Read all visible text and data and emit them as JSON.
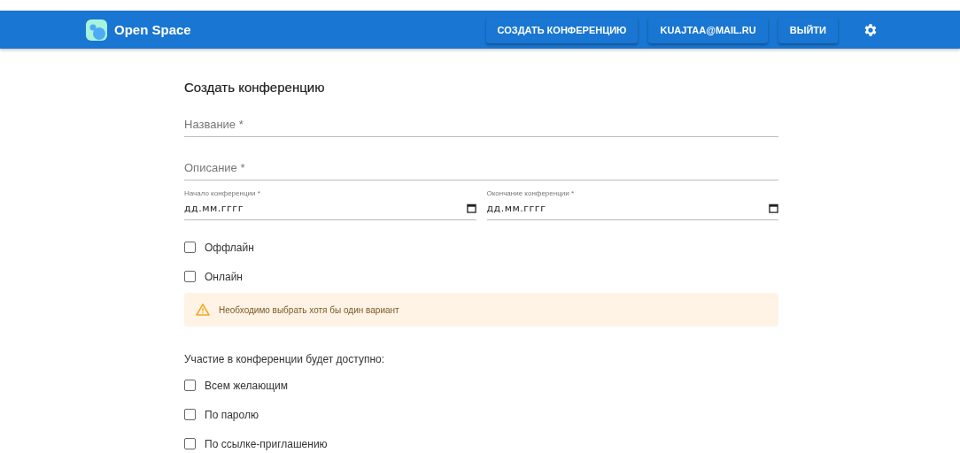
{
  "header": {
    "brand": "Open Space",
    "buttons": [
      "СОЗДАТЬ КОНФЕРЕНЦИЮ",
      "KUAJTAA@MAIL.RU",
      "ВЫЙТИ"
    ]
  },
  "form": {
    "title": "Создать конференцию",
    "fields": [
      {
        "placeholder": "Название *"
      },
      {
        "placeholder": "Описание *"
      }
    ],
    "dates": [
      {
        "label": "Начало конференции *",
        "placeholder": "дд.мм.гггг"
      },
      {
        "label": "Окончание конференции *",
        "placeholder": "дд.мм.гггг"
      }
    ],
    "formats": [
      {
        "label": "Оффлайн",
        "checked": false
      },
      {
        "label": "Онлайн",
        "checked": false
      }
    ],
    "warning": "Необходимо выбрать хотя бы один вариант",
    "access_label": "Участие в конференции будет доступно:",
    "access": [
      {
        "label": "Всем желающим",
        "checked": false
      },
      {
        "label": "По паролю",
        "checked": false
      },
      {
        "label": "По ссылке-приглашению",
        "checked": false
      }
    ]
  }
}
